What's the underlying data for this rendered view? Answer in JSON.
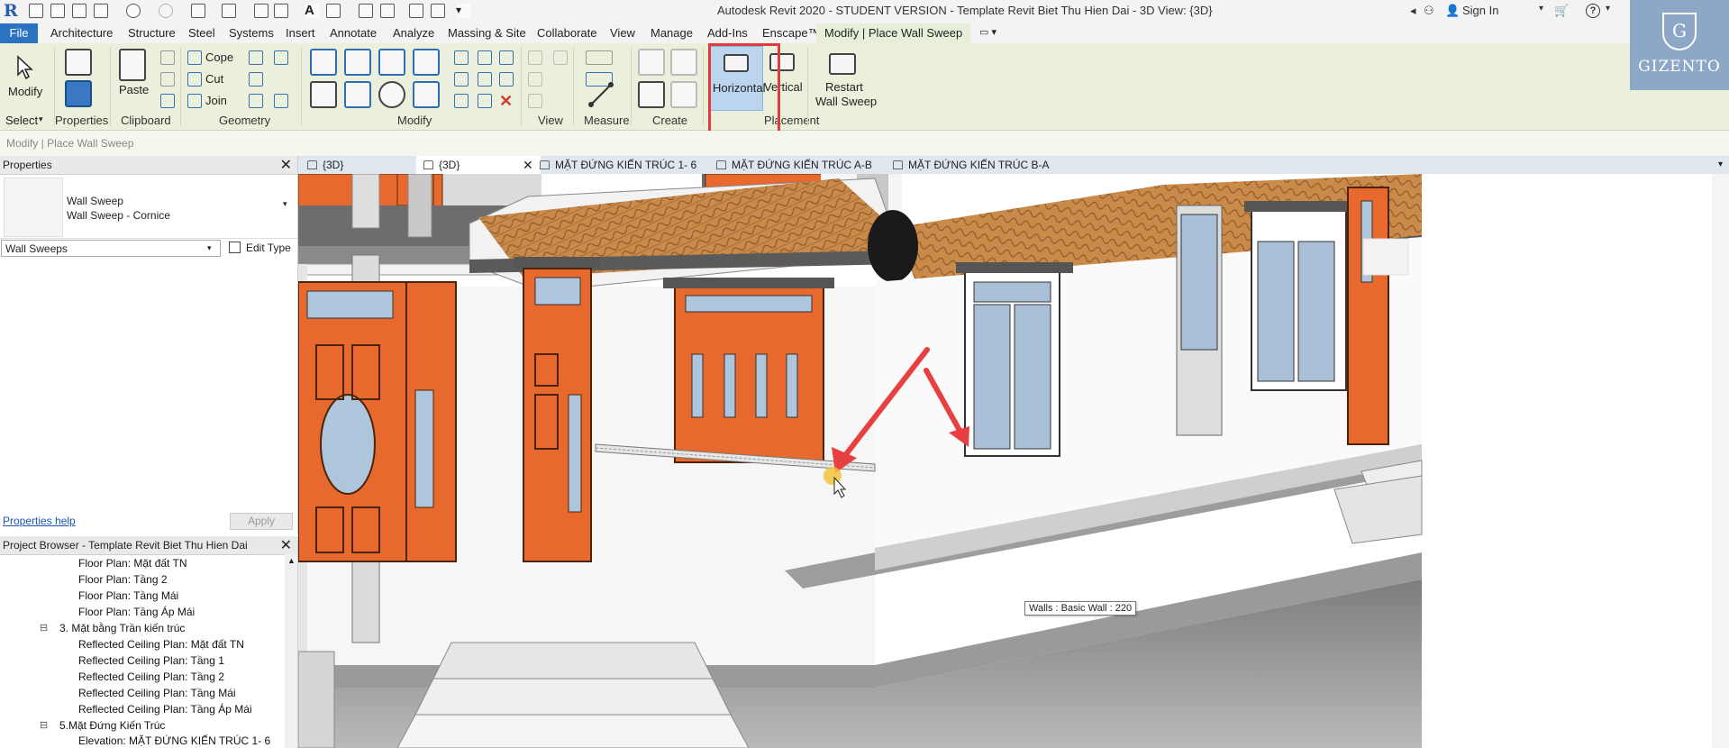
{
  "title_bar": {
    "app_logo": "R",
    "title": "Autodesk Revit 2020 - STUDENT VERSION - Template Revit Biet Thu Hien Dai - 3D View: {3D}",
    "sign_in": "Sign In"
  },
  "tabs": [
    "File",
    "Architecture",
    "Structure",
    "Steel",
    "Systems",
    "Insert",
    "Annotate",
    "Analyze",
    "Massing & Site",
    "Collaborate",
    "View",
    "Manage",
    "Add-Ins",
    "Enscape™"
  ],
  "active_tab": "Modify | Place Wall Sweep",
  "ribbon": {
    "modify_label": "Modify",
    "select_label": "Select",
    "properties_label": "Properties",
    "paste_label": "Paste",
    "clipboard_label": "Clipboard",
    "geometry_label": "Geometry",
    "cope": "Cope",
    "cut": "Cut",
    "join": "Join",
    "modify_panel_label": "Modify",
    "view_label": "View",
    "measure_label": "Measure",
    "create_label": "Create",
    "horizontal": "Horizontal",
    "vertical": "Vertical",
    "placement_label": "Placement",
    "restart_line1": "Restart",
    "restart_line2": "Wall Sweep"
  },
  "brand": {
    "crest": "G",
    "name": "GIZENTO"
  },
  "options_bar": "Modify | Place Wall Sweep",
  "properties": {
    "header": "Properties",
    "type_family": "Wall Sweep",
    "type_name": "Wall Sweep - Cornice",
    "category": "Wall Sweeps",
    "edit_type": "Edit Type",
    "help_link": "Properties help",
    "apply": "Apply"
  },
  "browser": {
    "header": "Project Browser - Template Revit Biet Thu Hien Dai",
    "items": [
      "Floor Plan: Mặt đất TN",
      "Floor Plan: Tầng 2",
      "Floor Plan: Tầng Mái",
      "Floor Plan: Tầng Áp Mái",
      "3. Mặt bằng Trần kiến trúc",
      "Reflected Ceiling Plan: Mặt đất TN",
      "Reflected Ceiling Plan: Tầng 1",
      "Reflected Ceiling Plan: Tầng 2",
      "Reflected Ceiling Plan: Tầng Mái",
      "Reflected Ceiling Plan: Tầng Áp Mái",
      "5.Mặt Đứng Kiến Trúc",
      "Elevation: MẶT ĐỨNG KIẾN TRÚC 1- 6"
    ]
  },
  "view_tabs": [
    "{3D}",
    "{3D}",
    "MẶT ĐỨNG KIẾN TRÚC 1- 6",
    "MẶT ĐỨNG KIẾN TRÚC A-B",
    "MẶT ĐỨNG KIẾN TRÚC B-A"
  ],
  "tooltip": "Walls : Basic Wall : 220",
  "colors": {
    "accent": "#2b72c2",
    "ribbon": "#eaf0dc",
    "highlight_box": "#e23b3b",
    "arrow": "#e84040",
    "door_orange": "#e8692d",
    "roof_tile": "#c98a4a"
  }
}
